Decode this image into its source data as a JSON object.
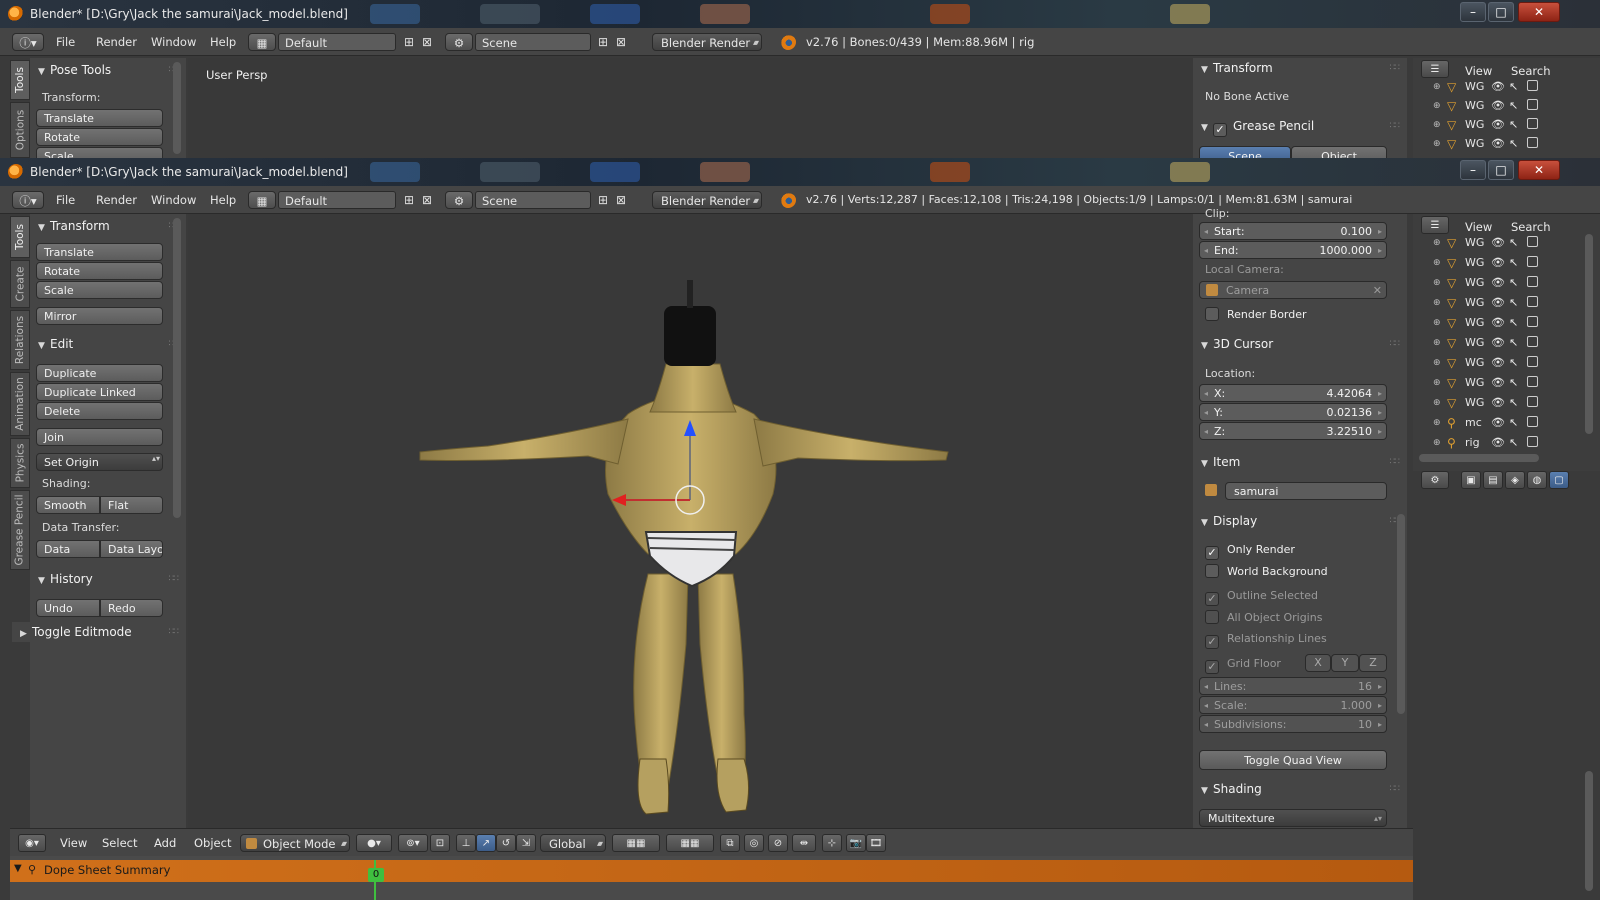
{
  "window_top": {
    "title": "Blender* [D:\\Gry\\Jack the samurai\\Jack_model.blend]",
    "controls": {
      "minimize": "–",
      "maximize": "□",
      "close": "✕"
    },
    "menus": [
      "File",
      "Render",
      "Window",
      "Help"
    ],
    "layout": "Default",
    "scene": "Scene",
    "engine": "Blender Render",
    "stats": "v2.76 | Bones:0/439  | Mem:88.96M | rig",
    "tabs": [
      "Tools",
      "Options"
    ],
    "tool_panel": {
      "title": "Pose Tools",
      "transform_label": "Transform:",
      "buttons": [
        "Translate",
        "Rotate",
        "Scale"
      ]
    },
    "viewport_label": "User Persp",
    "properties": {
      "transform_title": "Transform",
      "no_bone": "No Bone Active",
      "grease_title": "Grease Pencil",
      "grease_tabs": [
        "Scene",
        "Object"
      ]
    },
    "outliner": {
      "view": "View",
      "search": "Search",
      "rows": [
        "WG",
        "WG",
        "WG",
        "WG"
      ]
    }
  },
  "window_main": {
    "title": "Blender* [D:\\Gry\\Jack the samurai\\Jack_model.blend]",
    "controls": {
      "minimize": "–",
      "maximize": "□",
      "close": "✕"
    },
    "menus": [
      "File",
      "Render",
      "Window",
      "Help"
    ],
    "layout": "Default",
    "scene": "Scene",
    "engine": "Blender Render",
    "stats": "v2.76 | Verts:12,287 | Faces:12,108 | Tris:24,198 | Objects:1/9 | Lamps:0/1 | Mem:81.63M | samurai",
    "tabs": [
      "Tools",
      "Create",
      "Relations",
      "Animation",
      "Physics",
      "Grease Pencil"
    ],
    "tools": {
      "transform_title": "Transform",
      "translate": "Translate",
      "rotate": "Rotate",
      "scale": "Scale",
      "mirror": "Mirror",
      "edit_title": "Edit",
      "duplicate": "Duplicate",
      "duplicate_linked": "Duplicate Linked",
      "delete": "Delete",
      "join": "Join",
      "set_origin": "Set Origin",
      "shading_label": "Shading:",
      "smooth": "Smooth",
      "flat": "Flat",
      "data_transfer_label": "Data Transfer:",
      "data": "Data",
      "data_layo": "Data Layo",
      "history_title": "History",
      "undo": "Undo",
      "redo": "Redo",
      "toggle_editmode": "Toggle Editmode"
    },
    "properties": {
      "clip_label": "Clip:",
      "start_label": "Start:",
      "start_value": "0.100",
      "end_label": "End:",
      "end_value": "1000.000",
      "local_camera_label": "Local Camera:",
      "camera_placeholder": "Camera",
      "render_border": "Render Border",
      "cursor_title": "3D Cursor",
      "location_label": "Location:",
      "x_label": "X:",
      "x_value": "4.42064",
      "y_label": "Y:",
      "y_value": "0.02136",
      "z_label": "Z:",
      "z_value": "3.22510",
      "item_title": "Item",
      "item_name": "samurai",
      "display_title": "Display",
      "only_render": "Only Render",
      "world_background": "World Background",
      "outline_selected": "Outline Selected",
      "all_object_origins": "All Object Origins",
      "relationship_lines": "Relationship Lines",
      "grid_floor": "Grid Floor",
      "axis_x": "X",
      "axis_y": "Y",
      "axis_z": "Z",
      "lines_label": "Lines:",
      "lines_value": "16",
      "scale_label": "Scale:",
      "scale_value": "1.000",
      "subdivisions_label": "Subdivisions:",
      "subdivisions_value": "10",
      "toggle_quad_view": "Toggle Quad View",
      "shading_title": "Shading",
      "shading_mode": "Multitexture"
    },
    "outliner": {
      "view": "View",
      "search": "Search",
      "rows": [
        "WG",
        "WG",
        "WG",
        "WG",
        "WG",
        "WG",
        "WG",
        "WG",
        "WG",
        "mc",
        "rig"
      ]
    },
    "header3d": {
      "menus": [
        "View",
        "Select",
        "Add",
        "Object"
      ],
      "mode": "Object Mode",
      "orientation": "Global"
    },
    "dopesheet": {
      "label": "Dope Sheet Summary",
      "frame": "0"
    }
  }
}
